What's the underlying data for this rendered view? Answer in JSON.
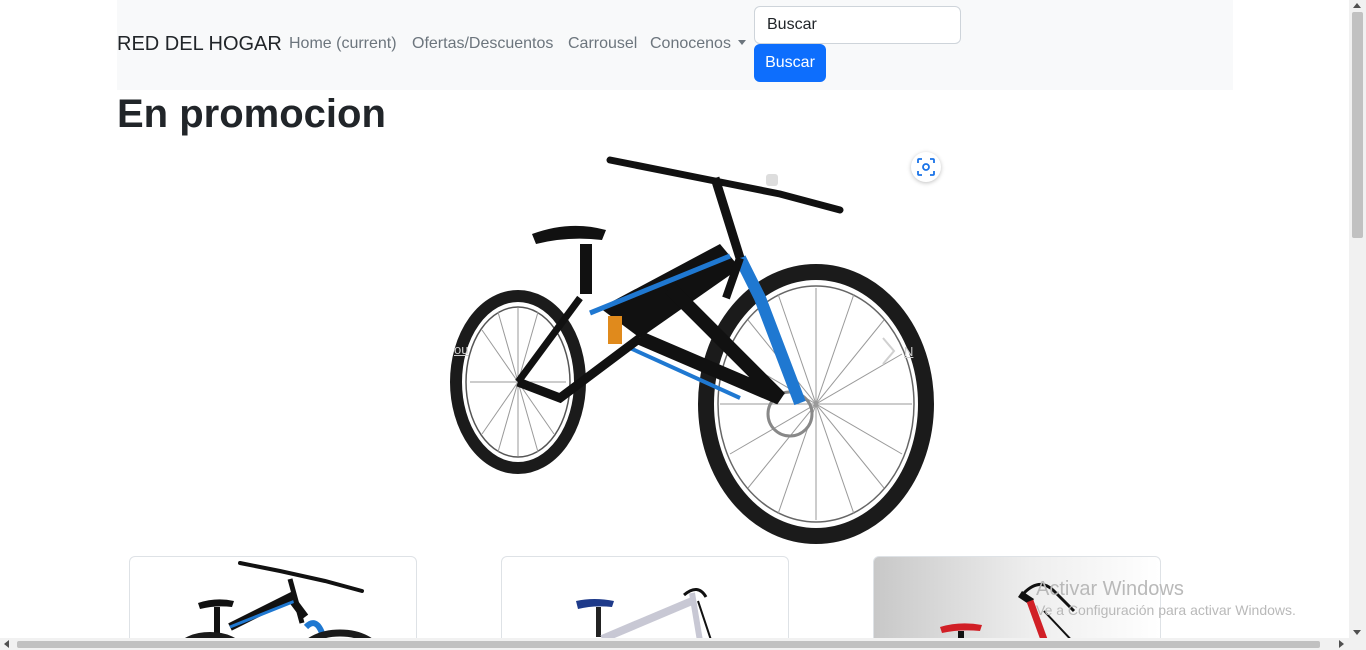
{
  "navbar": {
    "brand": "RED DEL HOGAR",
    "links": [
      {
        "label": "Home (current)"
      },
      {
        "label": "Ofertas/Descuentos"
      },
      {
        "label": "Carrousel"
      },
      {
        "label": "Conocenos"
      }
    ],
    "search": {
      "placeholder": "Buscar",
      "button_label": "Buscar"
    }
  },
  "main": {
    "title": "En promocion",
    "carousel": {
      "prev_text": "ou",
      "next_text": "N",
      "image": "mountain-bike-blue-black"
    },
    "cards": [
      {
        "image": "mountain-bike-blue-black"
      },
      {
        "image": "road-bike-silver-blue"
      },
      {
        "image": "bike-red"
      }
    ]
  },
  "watermark": {
    "title": "Activar Windows",
    "subtitle": "Ve a Configuración para activar Windows."
  },
  "colors": {
    "primary": "#0d6efd",
    "navbar_bg": "#f8f9fa",
    "bike_blue": "#1f78d1"
  }
}
